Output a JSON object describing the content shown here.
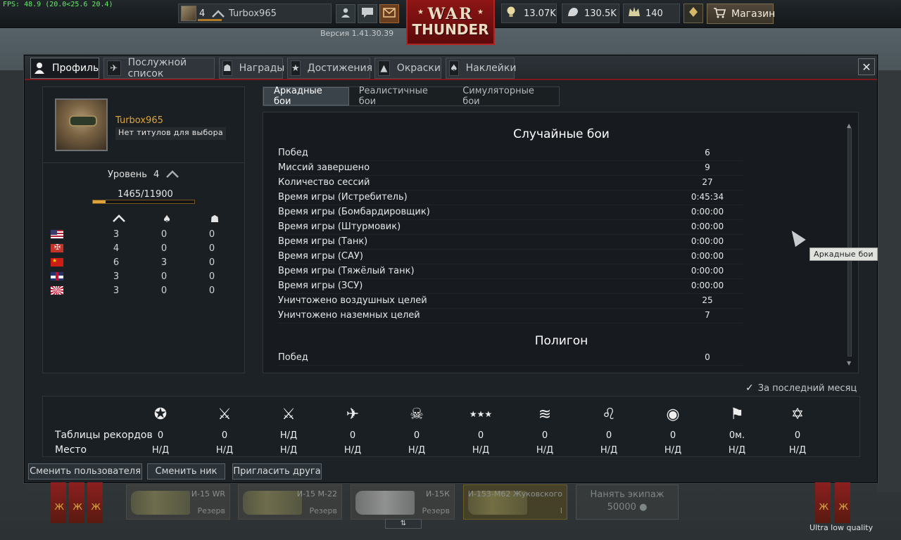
{
  "fps": "FPS: 48.9 (20.0<25.6 20.4)",
  "topbar": {
    "player_level": "4",
    "player_name": "Turbox965",
    "version": "Версия 1.41.30.39",
    "logo_top": "WAR",
    "logo_bottom": "THUNDER",
    "golden_eagles": "13.07K",
    "silver_lions": "130.5K",
    "research_points": "140",
    "shop_label": "Магазин"
  },
  "tabs": [
    {
      "label": "Профиль",
      "icon": "profile-icon"
    },
    {
      "label": "Послужной список",
      "icon": "service-record-icon"
    },
    {
      "label": "Награды",
      "icon": "medal-icon"
    },
    {
      "label": "Достижения",
      "icon": "achievement-icon"
    },
    {
      "label": "Окраски",
      "icon": "paint-icon"
    },
    {
      "label": "Наклейки",
      "icon": "decal-icon"
    }
  ],
  "profile": {
    "name": "Turbox965",
    "title": "Нет титулов для выбора",
    "level_label": "Уровень",
    "level_value": "4",
    "exp_text": "1465/11900",
    "exp_fraction": 0.123,
    "nations": [
      {
        "flag": "us",
        "a": "3",
        "b": "0",
        "c": "0"
      },
      {
        "flag": "de",
        "a": "4",
        "b": "0",
        "c": "0"
      },
      {
        "flag": "ru",
        "a": "6",
        "b": "3",
        "c": "0"
      },
      {
        "flag": "gb",
        "a": "3",
        "b": "0",
        "c": "0"
      },
      {
        "flag": "jp",
        "a": "3",
        "b": "0",
        "c": "0"
      }
    ]
  },
  "modes": [
    "Аркадные бои",
    "Реалистичные бои",
    "Симуляторные бои"
  ],
  "stats": {
    "section1_title": "Случайные бои",
    "rows": [
      {
        "name": "Побед",
        "value": "6"
      },
      {
        "name": "Миссий завершено",
        "value": "9"
      },
      {
        "name": "Количество сессий",
        "value": "27"
      },
      {
        "name": "Время игры (Истребитель)",
        "value": "0:45:34"
      },
      {
        "name": "Время игры (Бомбардировщик)",
        "value": "0:00:00"
      },
      {
        "name": "Время игры (Штурмовик)",
        "value": "0:00:00"
      },
      {
        "name": "Время игры (Танк)",
        "value": "0:00:00"
      },
      {
        "name": "Время игры (САУ)",
        "value": "0:00:00"
      },
      {
        "name": "Время игры (Тяжёлый танк)",
        "value": "0:00:00"
      },
      {
        "name": "Время игры (ЗСУ)",
        "value": "0:00:00"
      },
      {
        "name": "Уничтожено воздушных целей",
        "value": "25"
      },
      {
        "name": "Уничтожено наземных целей",
        "value": "7"
      }
    ],
    "section2_title": "Полигон",
    "section2_first_row": "Побед",
    "section2_first_value": "0"
  },
  "tooltip": "Аркадные бои",
  "last_month_label": "За последний месяц",
  "records": {
    "row1_label": "Таблицы рекордов",
    "row2_label": "Место",
    "columns": [
      {
        "icon": "eagle-star-icon",
        "value": "0",
        "place": "Н/Д"
      },
      {
        "icon": "crossed-swords-icon",
        "value": "0",
        "place": "Н/Д"
      },
      {
        "icon": "swords-star-icon",
        "value": "Н/Д",
        "place": "Н/Д"
      },
      {
        "icon": "plane-icon",
        "value": "0",
        "place": "Н/Д"
      },
      {
        "icon": "skull-icon",
        "value": "0",
        "place": "Н/Д"
      },
      {
        "icon": "stars-icon",
        "value": "0",
        "place": "Н/Д"
      },
      {
        "icon": "boats-icon",
        "value": "0",
        "place": "Н/Д"
      },
      {
        "icon": "lion-icon",
        "value": "0",
        "place": "Н/Д"
      },
      {
        "icon": "lightbulb-icon",
        "value": "0",
        "place": "Н/Д"
      },
      {
        "icon": "flag-timer-icon",
        "value": "0м.",
        "place": "Н/Д"
      },
      {
        "icon": "star-emblem-icon",
        "value": "0",
        "place": "Н/Д"
      }
    ]
  },
  "buttons": {
    "switch_user": "Сменить пользователя",
    "change_nick": "Сменить ник",
    "invite_friend": "Пригласить друга"
  },
  "hangar": {
    "slots": [
      {
        "name": "И-15 WR",
        "status": "Резерв"
      },
      {
        "name": "И-15 М-22",
        "status": "Резерв"
      },
      {
        "name": "И-15К",
        "status": "Резерв"
      },
      {
        "name": "И-153-М62 Жуковского",
        "status": "I"
      }
    ],
    "hire_label": "Нанять экипаж",
    "hire_cost": "50000"
  },
  "quality_label": "Ultra low quality",
  "colors": {
    "accent_orange": "#e0a43a",
    "window_bg": "#1d2227",
    "logo_red": "#8e1515"
  }
}
